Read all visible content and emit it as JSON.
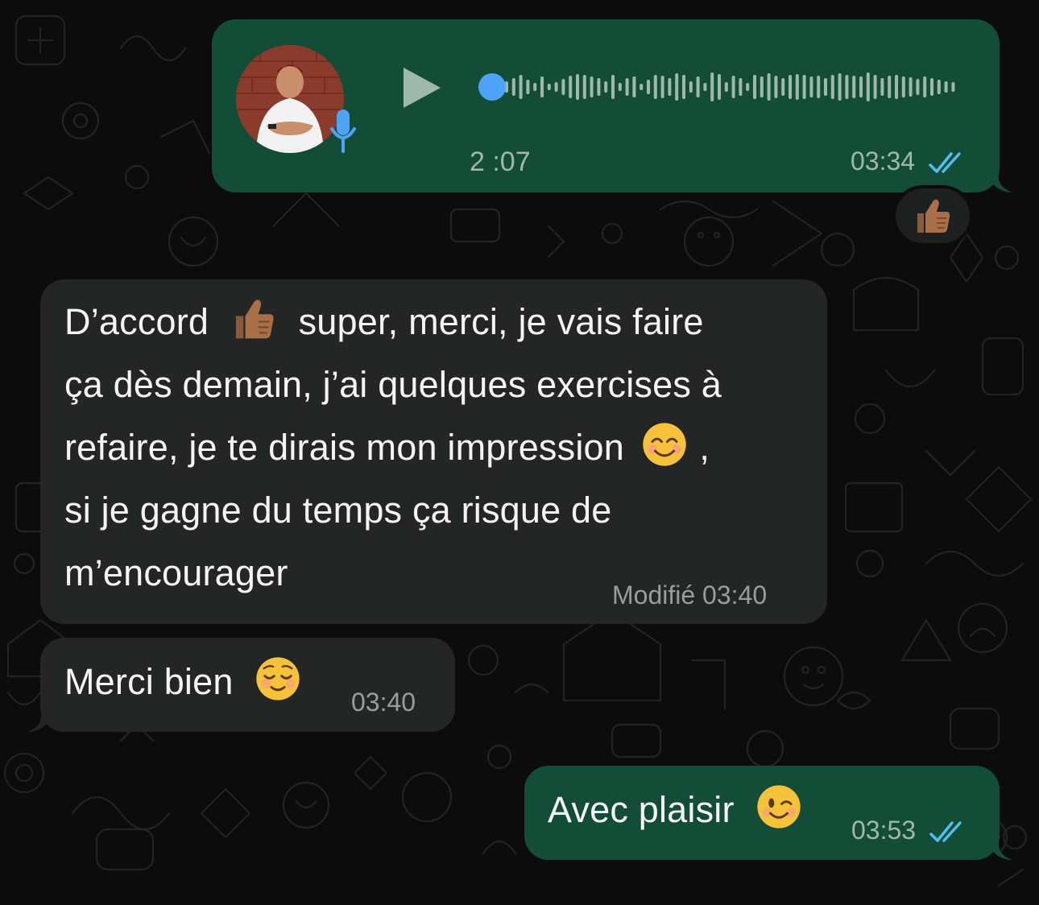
{
  "colors": {
    "outgoing_bubble": "#144d37",
    "incoming_bubble": "#242626",
    "background": "#0c0c0c",
    "read_ticks": "#53bdeb",
    "playhead": "#4fa3f7"
  },
  "voice_message": {
    "duration": "2 :07",
    "time": "03:34",
    "status_icon": "double-check-read-icon",
    "play_icon": "play-icon",
    "mic_icon": "microphone-icon",
    "progress": 0.0
  },
  "reaction": {
    "emoji_icon": "thumbs-up-medium-dark-skin-icon"
  },
  "message_1": {
    "lines": [
      "D’accord",
      "super, merci, je vais faire",
      "ça dès demain, j’ai quelques exercises à",
      "refaire, je te dirais mon impression",
      ",",
      "si je gagne du temps ça risque de",
      "m’encourager"
    ],
    "meta": "Modifié 03:40"
  },
  "message_2": {
    "text": "Merci bien",
    "time": "03:40"
  },
  "message_3": {
    "text": "Avec plaisir",
    "time": "03:53",
    "status_icon": "double-check-read-icon"
  }
}
